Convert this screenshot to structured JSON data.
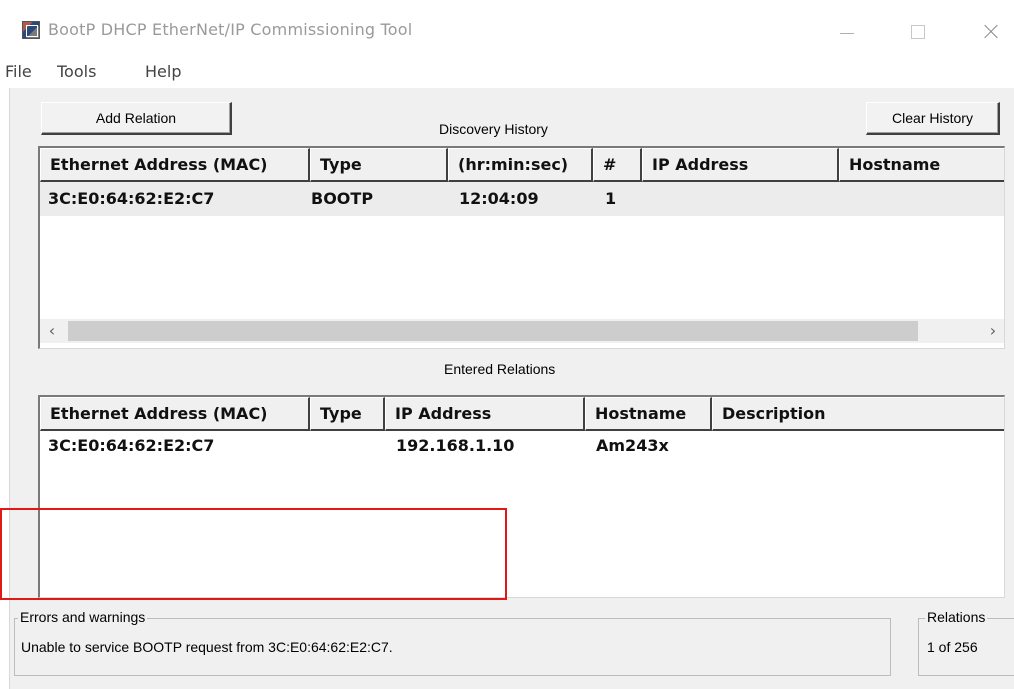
{
  "window": {
    "title": "BootP DHCP EtherNet/IP Commissioning Tool",
    "app_icon": "bootp-app-icon",
    "controls": [
      "minimize-icon",
      "maximize-icon",
      "close-icon"
    ]
  },
  "menu": {
    "file": "File",
    "tools": "Tools",
    "help": "Help"
  },
  "toolbar": {
    "add_relation": "Add Relation",
    "clear_history": "Clear History"
  },
  "discovery": {
    "label": "Discovery History",
    "columns": [
      "Ethernet Address (MAC)",
      "Type",
      "(hr:min:sec)",
      "#",
      "IP Address",
      "Hostname"
    ],
    "rows": [
      {
        "mac": "3C:E0:64:62:E2:C7",
        "type": "BOOTP",
        "time": "12:04:09",
        "count": "1",
        "ip": "",
        "hostname": ""
      }
    ],
    "scroll_left": "‹",
    "scroll_right": "›"
  },
  "relations": {
    "label": "Entered Relations",
    "columns": [
      "Ethernet Address (MAC)",
      "Type",
      "IP Address",
      "Hostname",
      "Description"
    ],
    "rows": [
      {
        "mac": "3C:E0:64:62:E2:C7",
        "type": "",
        "ip": "192.168.1.10",
        "hostname": "Am243x",
        "description": ""
      }
    ]
  },
  "status": {
    "errors_title": "Errors and warnings",
    "errors_message": "Unable to service BOOTP request from 3C:E0:64:62:E2:C7.",
    "relations_title": "Relations",
    "relations_count": "1 of 256"
  },
  "colors": {
    "highlight": "#e01818",
    "client_bg": "#f0f0f0"
  }
}
